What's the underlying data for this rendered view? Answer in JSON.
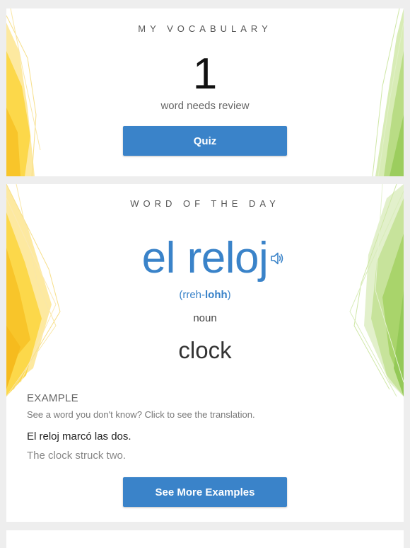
{
  "vocabulary": {
    "heading": "MY VOCABULARY",
    "count": "1",
    "count_label": "word needs review",
    "quiz_label": "Quiz"
  },
  "word_of_the_day": {
    "heading": "WORD OF THE DAY",
    "word": "el reloj",
    "speaker_icon": "speaker-icon",
    "pronunciation_prefix": "(rreh-",
    "pronunciation_stress": "lohh",
    "pronunciation_suffix": ")",
    "part_of_speech": "noun",
    "translation": "clock",
    "example": {
      "heading": "EXAMPLE",
      "hint": "See a word you don't know? Click to see the translation.",
      "sentence": "El reloj marcó las dos.",
      "sentence_translation": "The clock struck two."
    },
    "more_examples_label": "See More Examples"
  },
  "colors": {
    "accent": "#3a83c9",
    "yellow_decor": "#fdd335",
    "green_decor": "#a9d46b",
    "background": "#eeeeee"
  }
}
